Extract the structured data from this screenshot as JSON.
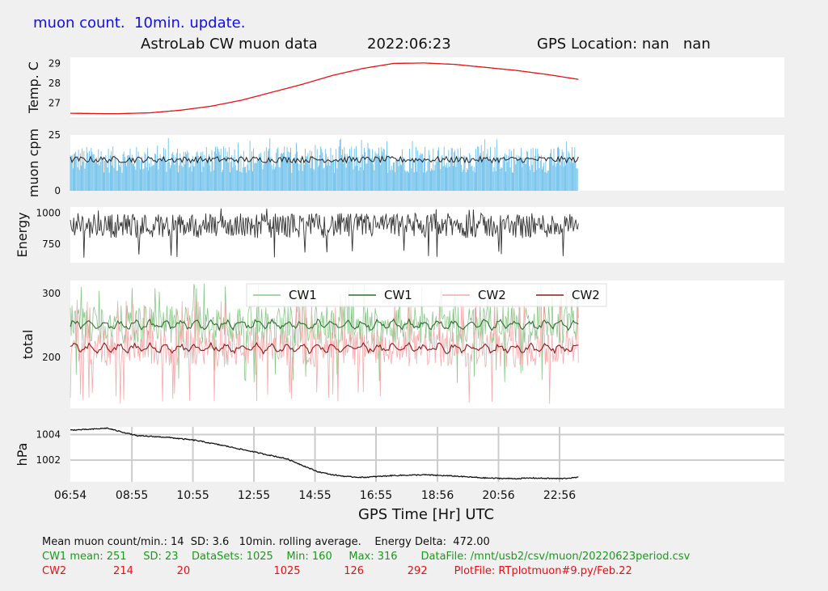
{
  "header": {
    "note": "muon count.  10min. update.",
    "title": "AstroLab CW muon data",
    "date": "2022:06:23",
    "gps": "GPS Location: nan   nan"
  },
  "footer": {
    "line1": "Mean muon count/min.: 14  SD: 3.6   10min. rolling average.    Energy Delta:  472.00",
    "line2": "CW1 mean: 251     SD: 23    DataSets: 1025    Min: 160     Max: 316       DataFile: /mnt/usb2/csv/muon/20220623period.csv",
    "line3": "CW2              214             20                         1025             126             292        PlotFile: RTplotmuon#9.py/Feb.22"
  },
  "chart_data": [
    {
      "type": "line",
      "ylabel": "Temp. C",
      "ylim": [
        26.3,
        29.3
      ],
      "yticks": [
        27,
        28,
        29
      ],
      "series": [
        {
          "color": "#e61010",
          "x_hours": [
            6.9,
            8.0,
            8.5,
            9.5,
            10.5,
            11.5,
            12.5,
            13.5,
            14.5,
            15.5,
            16.5,
            17.5,
            18.5,
            19.5,
            20.5,
            21.5,
            22.5,
            23.55
          ],
          "values": [
            26.5,
            26.48,
            26.48,
            26.52,
            26.65,
            26.85,
            27.15,
            27.55,
            27.95,
            28.4,
            28.75,
            29.0,
            29.02,
            28.95,
            28.8,
            28.65,
            28.45,
            28.2
          ]
        }
      ]
    },
    {
      "type": "bar",
      "ylabel": "muon cpm",
      "ylim": [
        0,
        25
      ],
      "yticks": [
        0,
        25
      ],
      "raw_color": "#5bb8e8",
      "raw_min": 8,
      "raw_max": 24,
      "avg_color": "#222222",
      "avg_value": 14,
      "avg_min": 12,
      "avg_max": 16
    },
    {
      "type": "line",
      "ylabel": "Energy",
      "ylim": [
        600,
        1050
      ],
      "yticks": [
        750,
        1000
      ],
      "series": [
        {
          "color": "#333333",
          "typical_min": 800,
          "typical_max": 1000,
          "overall_min": 640,
          "overall_max": 1040
        }
      ]
    },
    {
      "type": "line",
      "ylabel": "total",
      "ylim": [
        120,
        320
      ],
      "yticks": [
        200,
        300
      ],
      "legend": [
        "CW1",
        "CW1",
        "CW2",
        "CW2"
      ],
      "legend_colors": [
        "#88c888",
        "#2e6b2e",
        "#f4aaaa",
        "#8b1a1a"
      ],
      "series": [
        {
          "name": "CW1",
          "color": "#88c888",
          "mean": 251,
          "min": 160,
          "max": 316
        },
        {
          "name": "CW1",
          "color": "#2e6b2e",
          "mean": 251,
          "amplitude": 8
        },
        {
          "name": "CW2",
          "color": "#f4aaaa",
          "mean": 214,
          "min": 126,
          "max": 292
        },
        {
          "name": "CW2",
          "color": "#8b1a1a",
          "mean": 214,
          "amplitude": 8
        }
      ]
    },
    {
      "type": "line",
      "ylabel": "hPa",
      "xlabel": "GPS Time  [Hr] UTC",
      "ylim": [
        1000.3,
        1004.6
      ],
      "yticks": [
        1002,
        1004
      ],
      "grid": true,
      "series": [
        {
          "color": "#111111",
          "x_hours": [
            6.9,
            7.5,
            8.1,
            8.6,
            9.1,
            10.0,
            11.0,
            12.0,
            13.0,
            14.0,
            14.5,
            15.0,
            15.5,
            16.0,
            16.5,
            17.5,
            18.5,
            19.5,
            20.5,
            21.5,
            22.0,
            23.0,
            23.55
          ],
          "values": [
            1004.35,
            1004.4,
            1004.5,
            1004.2,
            1003.9,
            1003.8,
            1003.55,
            1003.1,
            1002.6,
            1002.1,
            1001.6,
            1001.1,
            1000.85,
            1000.7,
            1000.65,
            1000.8,
            1000.85,
            1000.75,
            1000.6,
            1000.55,
            1000.6,
            1000.55,
            1000.65
          ]
        }
      ]
    }
  ],
  "xaxis": {
    "ticks": [
      "06:54",
      "08:55",
      "10:55",
      "12:55",
      "14:55",
      "16:55",
      "18:56",
      "20:56",
      "22:56"
    ],
    "tick_hours": [
      6.9,
      8.917,
      10.917,
      12.917,
      14.917,
      16.917,
      18.933,
      20.933,
      22.933
    ],
    "xlim_hours": [
      6.9,
      30.3
    ]
  }
}
